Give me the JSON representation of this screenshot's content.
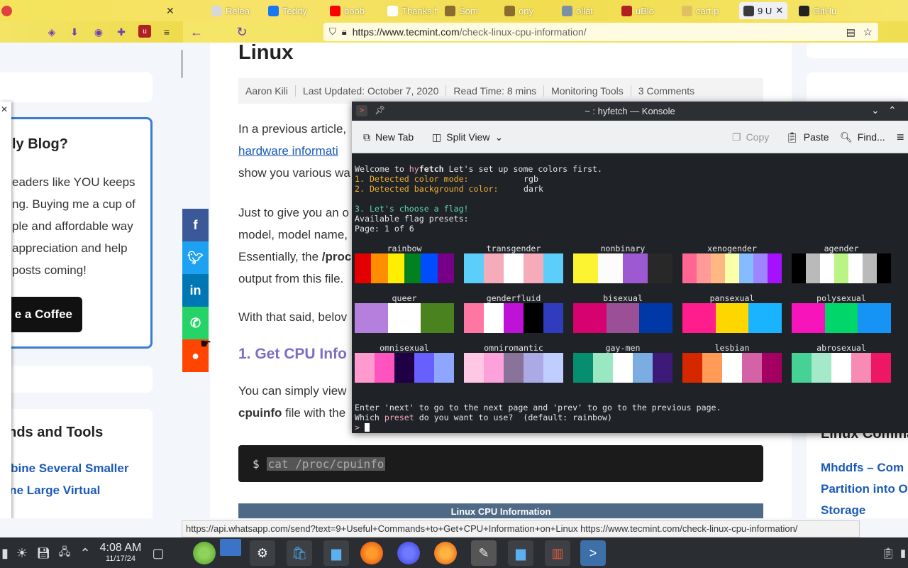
{
  "browser": {
    "tabs": [
      {
        "label": "Relea",
        "color": "#d8d8d8"
      },
      {
        "label": "Teddy",
        "color": "#1877f2"
      },
      {
        "label": "boob",
        "color": "#ff0000"
      },
      {
        "label": "Thanks f",
        "color": "#ffffff"
      },
      {
        "label": "Som",
        "color": "#8b6b2f"
      },
      {
        "label": "ony",
        "color": "#8b6b2f"
      },
      {
        "label": "ollat",
        "color": "#7b8fa6"
      },
      {
        "label": "uBlo",
        "color": "#b02222"
      },
      {
        "label": "cart.p",
        "color": "#e0c060"
      },
      {
        "label": "9 U",
        "color": "#3a3a3a"
      },
      {
        "label": "GitHu",
        "color": "#222222"
      }
    ],
    "url_host": "https://www.tecmint.com",
    "url_path": "/check-linux-cpu-information/"
  },
  "sidebar_left": {
    "blog_title": "ly Blog?",
    "blog_text": [
      "eaders like YOU keeps",
      "ng. Buying me a cup of",
      "ple and affordable way",
      "appreciation and help",
      "posts coming!"
    ],
    "coffee_label": "e a Coffee",
    "commands_title": "ands and Tools",
    "link1": "mbine Several Smaller",
    "link2": "One Large Virtual"
  },
  "article": {
    "title": "Linux",
    "author": "Aaron Kili",
    "updated": "Last Updated: October 7, 2020",
    "readtime": "Read Time: 8 mins",
    "category": "Monitoring Tools",
    "comments": "3 Comments",
    "p1_line1": "In a previous article,",
    "p1_link": "hardware informati",
    "p1_line3": "show you various wa",
    "p2_line1": "Just to give you an o",
    "p2_line2": "model, model name,",
    "p2_line3_pre": "Essentially, the ",
    "p2_line3_bold": "/proc",
    "p2_line4": "output from this file.",
    "p3": "With that said, belov",
    "heading": "1. Get CPU Info",
    "p4_line1": "You can simply view",
    "p4_bold": "cpuinfo",
    "p4_line2": " file with the",
    "code_prompt": "$",
    "code_cmd": "cat /proc/cpuinfo",
    "table_header": "Linux CPU Information"
  },
  "sidebar_right": {
    "title": "Linux Comma",
    "link1": "Mhddfs – Com",
    "link2": "Partition into O",
    "link3": "Storage"
  },
  "konsole": {
    "title": "~ : hyfetch — Konsole",
    "new_tab": "New Tab",
    "split_view": "Split View",
    "copy": "Copy",
    "paste": "Paste",
    "find": "Find...",
    "lines": {
      "welcome_pre": "Welcome to ",
      "welcome_hy": "hy",
      "welcome_fetch": "fetch",
      "welcome_post": " Let's set up some colors first.",
      "l1": "1. Detected color mode:",
      "l1v": "rgb",
      "l2": "2. Detected background color:",
      "l2v": "dark",
      "l3": "3. Let's choose a flag!",
      "l4": "Available flag presets:",
      "l5": "Page: 1 of 6",
      "l6": "Enter 'next' to go to the next page and 'prev' to go to the previous page.",
      "l7_pre": "Which ",
      "l7_preset": "preset",
      "l7_post": " do you want to use?  (default: rainbow)",
      "prompt": ">"
    },
    "flags": [
      {
        "name": "rainbow",
        "colors": [
          "#e50000",
          "#ff8d00",
          "#ffee00",
          "#028121",
          "#004cff",
          "#770088"
        ]
      },
      {
        "name": "transgender",
        "colors": [
          "#5bcffa",
          "#f5abb9",
          "#ffffff",
          "#f5abb9",
          "#5bcffa"
        ]
      },
      {
        "name": "nonbinary",
        "colors": [
          "#fcf431",
          "#fcfcfc",
          "#9d59d2",
          "#282828"
        ]
      },
      {
        "name": "xenogender",
        "colors": [
          "#ff6692",
          "#ff9a98",
          "#ffb883",
          "#fbffa8",
          "#85bcff",
          "#9d85ff",
          "#a510ff"
        ]
      },
      {
        "name": "agender",
        "colors": [
          "#000000",
          "#bababa",
          "#ffffff",
          "#baf484",
          "#ffffff",
          "#bababa",
          "#000000"
        ]
      },
      {
        "name": "queer",
        "colors": [
          "#b57fdd",
          "#ffffff",
          "#49821e"
        ]
      },
      {
        "name": "genderfluid",
        "colors": [
          "#fe76a2",
          "#ffffff",
          "#bf12d7",
          "#000000",
          "#303cbe"
        ]
      },
      {
        "name": "bisexual",
        "colors": [
          "#d60270",
          "#9b4f96",
          "#0038a8"
        ]
      },
      {
        "name": "pansexual",
        "colors": [
          "#ff1c8d",
          "#ffd700",
          "#1ab3ff"
        ]
      },
      {
        "name": "polysexual",
        "colors": [
          "#f714ba",
          "#01d66a",
          "#1594f6"
        ]
      },
      {
        "name": "omnisexual",
        "colors": [
          "#fe9ace",
          "#ff53bf",
          "#200044",
          "#6760fe",
          "#8ea6ff"
        ]
      },
      {
        "name": "omniromantic",
        "colors": [
          "#fec8e4",
          "#fda1db",
          "#89739a",
          "#abaae4",
          "#bfceff"
        ]
      },
      {
        "name": "gay-men",
        "colors": [
          "#078d70",
          "#98e8c1",
          "#ffffff",
          "#7bade2",
          "#3d1a78"
        ]
      },
      {
        "name": "lesbian",
        "colors": [
          "#d62800",
          "#ff9b56",
          "#ffffff",
          "#d462a6",
          "#a40062"
        ]
      },
      {
        "name": "abrosexual",
        "colors": [
          "#46d294",
          "#a3e9ca",
          "#ffffff",
          "#f78bb3",
          "#ee1766"
        ]
      }
    ]
  },
  "status_url": "https://api.whatsapp.com/send?text=9+Useful+Commands+to+Get+CPU+Information+on+Linux https://www.tecmint.com/check-linux-cpu-information/",
  "taskbar": {
    "time": "4:08 AM",
    "date": "11/17/24"
  }
}
